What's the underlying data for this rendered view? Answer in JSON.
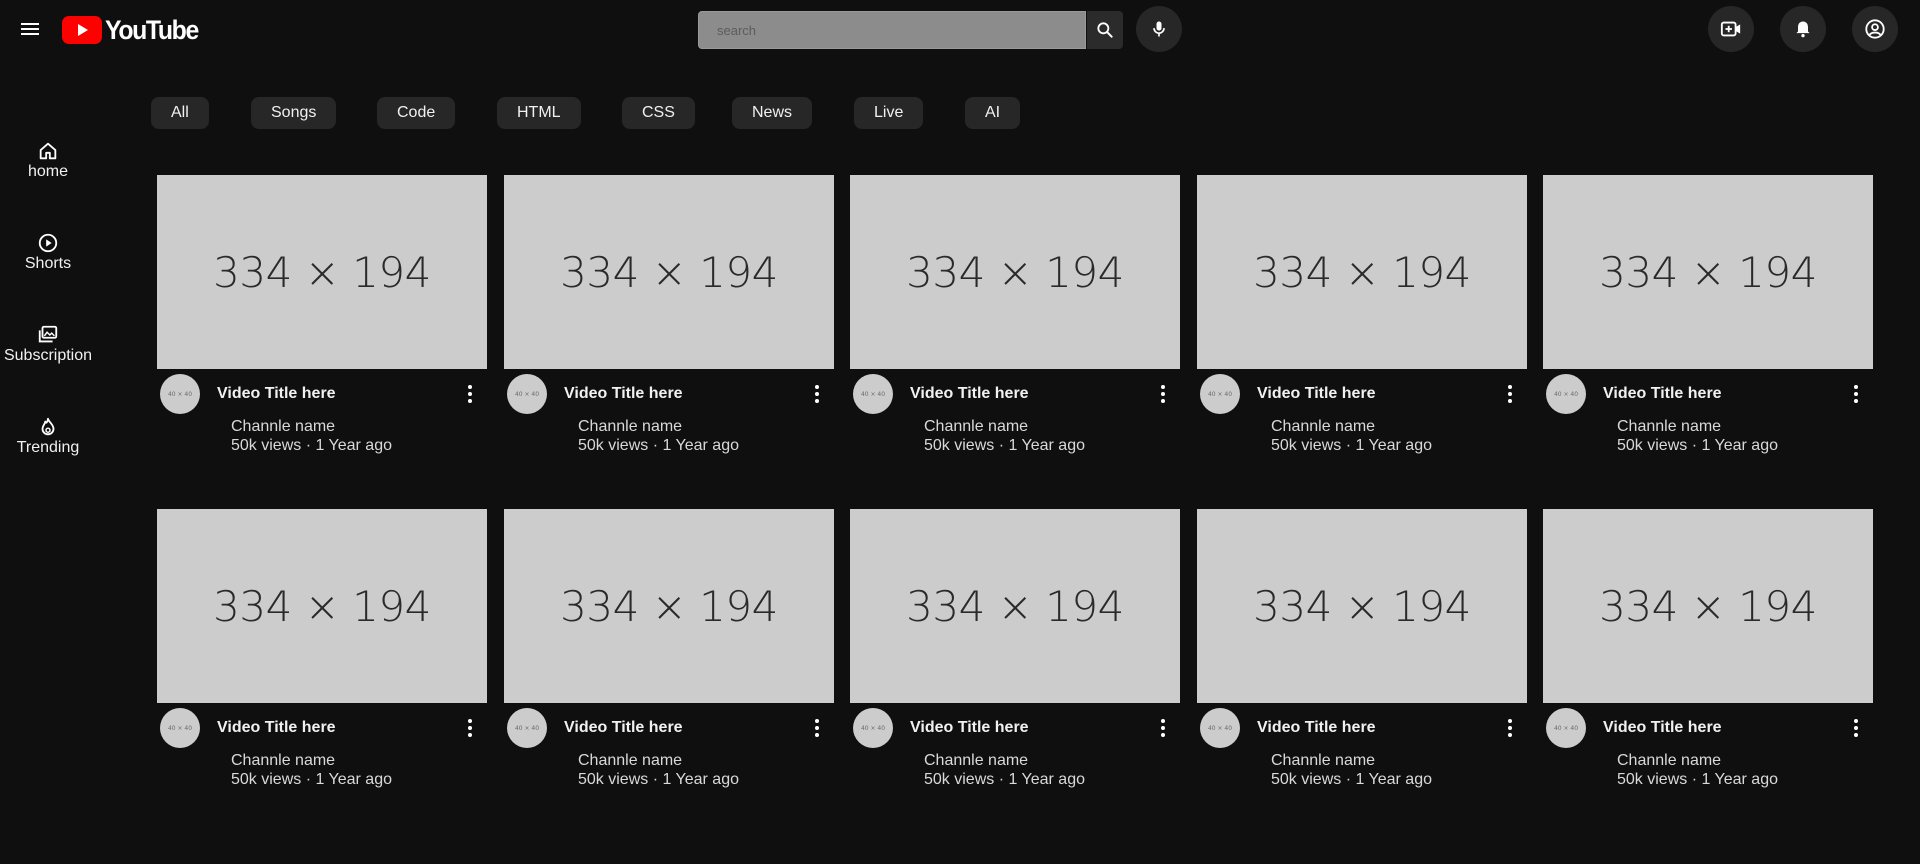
{
  "header": {
    "logo_text": "YouTube",
    "search_placeholder": "search",
    "brand_color": "#ff0000",
    "icons": [
      "menu-icon",
      "search-icon",
      "mic-icon",
      "create-video-icon",
      "bell-icon",
      "account-icon"
    ]
  },
  "sidebar": {
    "items": [
      {
        "label": "home",
        "icon": "home-icon"
      },
      {
        "label": "Shorts",
        "icon": "shorts-icon"
      },
      {
        "label": "Subscription",
        "icon": "subscription-icon"
      },
      {
        "label": "Trending",
        "icon": "trending-icon"
      }
    ]
  },
  "chips": [
    "All",
    "Songs",
    "Code",
    "HTML",
    "CSS",
    "News",
    "Live",
    "AI"
  ],
  "videos": [
    {
      "thumb": "334 × 194",
      "avatar": "40 × 40",
      "title": "Video Title here",
      "channel": "Channle name",
      "stats": "50k views · 1 Year ago"
    },
    {
      "thumb": "334 × 194",
      "avatar": "40 × 40",
      "title": "Video Title here",
      "channel": "Channle name",
      "stats": "50k views · 1 Year ago"
    },
    {
      "thumb": "334 × 194",
      "avatar": "40 × 40",
      "title": "Video Title here",
      "channel": "Channle name",
      "stats": "50k views · 1 Year ago"
    },
    {
      "thumb": "334 × 194",
      "avatar": "40 × 40",
      "title": "Video Title here",
      "channel": "Channle name",
      "stats": "50k views · 1 Year ago"
    },
    {
      "thumb": "334 × 194",
      "avatar": "40 × 40",
      "title": "Video Title here",
      "channel": "Channle name",
      "stats": "50k views · 1 Year ago"
    },
    {
      "thumb": "334 × 194",
      "avatar": "40 × 40",
      "title": "Video Title here",
      "channel": "Channle name",
      "stats": "50k views · 1 Year ago"
    },
    {
      "thumb": "334 × 194",
      "avatar": "40 × 40",
      "title": "Video Title here",
      "channel": "Channle name",
      "stats": "50k views · 1 Year ago"
    },
    {
      "thumb": "334 × 194",
      "avatar": "40 × 40",
      "title": "Video Title here",
      "channel": "Channle name",
      "stats": "50k views · 1 Year ago"
    },
    {
      "thumb": "334 × 194",
      "avatar": "40 × 40",
      "title": "Video Title here",
      "channel": "Channle name",
      "stats": "50k views · 1 Year ago"
    },
    {
      "thumb": "334 × 194",
      "avatar": "40 × 40",
      "title": "Video Title here",
      "channel": "Channle name",
      "stats": "50k views · 1 Year ago"
    }
  ]
}
